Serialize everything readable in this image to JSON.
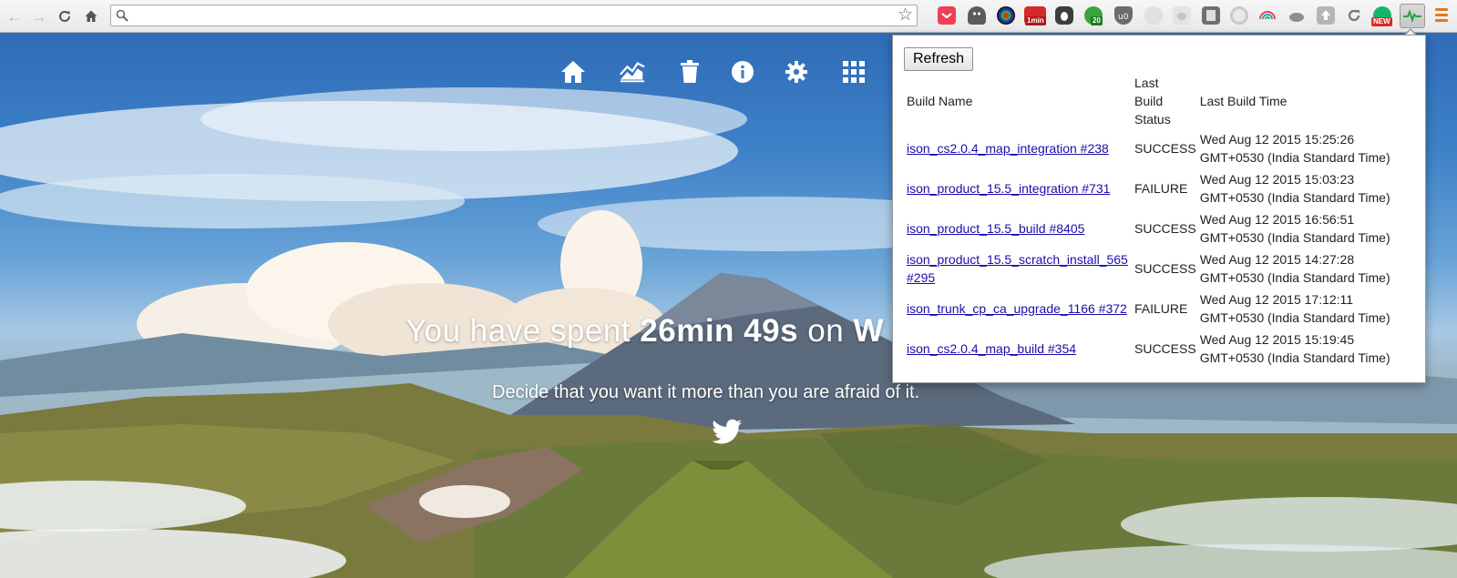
{
  "browser": {
    "address_value": "",
    "extensions": [
      {
        "name": "pocket-icon",
        "color": "#ee4056"
      },
      {
        "name": "ghostery-icon",
        "color": "#4c4c4c"
      },
      {
        "name": "colorpick-icon",
        "color": "#222222"
      },
      {
        "name": "1min-icon",
        "badge": "1min",
        "color": "#d32b2b"
      },
      {
        "name": "evernote-icon",
        "color": "#3d3d3d"
      },
      {
        "name": "counter-icon",
        "badge": "20",
        "color": "#3aa33a"
      },
      {
        "name": "ublock-icon",
        "color": "#6b6b6b"
      },
      {
        "name": "bulb-icon",
        "color": "#bdbdbd"
      },
      {
        "name": "bug-icon",
        "color": "#c4c4c4"
      },
      {
        "name": "notes-icon",
        "color": "#6f6f6f"
      },
      {
        "name": "circle-icon",
        "color": "#c9c9c9"
      },
      {
        "name": "rainbow-icon",
        "color": "#2c9be8"
      },
      {
        "name": "cloud-icon",
        "color": "#8e8e8e"
      },
      {
        "name": "upload-icon",
        "color": "#9c9c9c"
      },
      {
        "name": "sync-icon",
        "color": "#7b7b7b"
      },
      {
        "name": "grammarly-icon",
        "badge": "NEW",
        "color": "#15b46b"
      },
      {
        "name": "pulse-icon",
        "color": "#2ea043"
      }
    ]
  },
  "page": {
    "headline_prefix": "You have spent ",
    "headline_time": "26min 49s",
    "headline_mid": " on ",
    "headline_site": "W",
    "quote": "Decide that you want it more than you are afraid of it."
  },
  "popup": {
    "refresh_label": "Refresh",
    "headers": {
      "name": "Build Name",
      "status": "Last Build Status",
      "time": "Last Build Time"
    },
    "builds": [
      {
        "name": "ison_cs2.0.4_map_integration #238",
        "status": "SUCCESS",
        "time": "Wed Aug 12 2015 15:25:26 GMT+0530 (India Standard Time)"
      },
      {
        "name": "ison_product_15.5_integration #731",
        "status": "FAILURE",
        "time": "Wed Aug 12 2015 15:03:23 GMT+0530 (India Standard Time)"
      },
      {
        "name": "ison_product_15.5_build #8405",
        "status": "SUCCESS",
        "time": "Wed Aug 12 2015 16:56:51 GMT+0530 (India Standard Time)"
      },
      {
        "name": "ison_product_15.5_scratch_install_565 #295",
        "status": "SUCCESS",
        "time": "Wed Aug 12 2015 14:27:28 GMT+0530 (India Standard Time)"
      },
      {
        "name": "ison_trunk_cp_ca_upgrade_1166 #372",
        "status": "FAILURE",
        "time": "Wed Aug 12 2015 17:12:11 GMT+0530 (India Standard Time)"
      },
      {
        "name": "ison_cs2.0.4_map_build #354",
        "status": "SUCCESS",
        "time": "Wed Aug 12 2015 15:19:45 GMT+0530 (India Standard Time)"
      }
    ]
  }
}
